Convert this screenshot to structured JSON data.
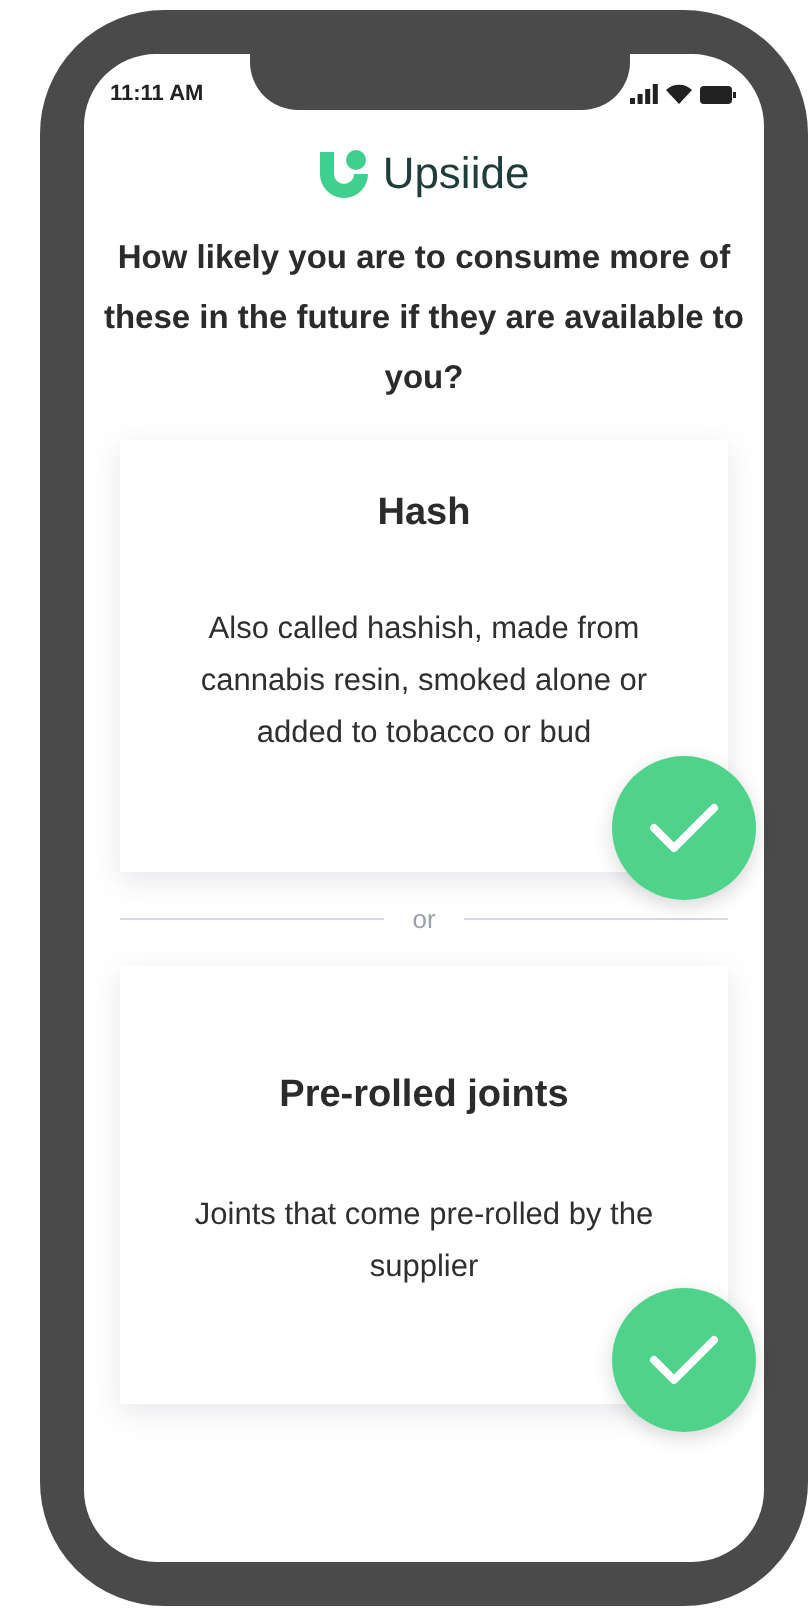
{
  "status_bar": {
    "time": "11:11 AM"
  },
  "brand": {
    "name": "Upsiide"
  },
  "question": "How likely you are to consume more of these in the future if they are available to you?",
  "options": [
    {
      "title": "Hash",
      "description": "Also called hashish, made from cannabis resin, smoked alone or added to tobacco or bud",
      "selected": true
    },
    {
      "title": "Pre-rolled joints",
      "description": "Joints that come pre-rolled by the supplier",
      "selected": true
    }
  ],
  "divider_text": "or"
}
